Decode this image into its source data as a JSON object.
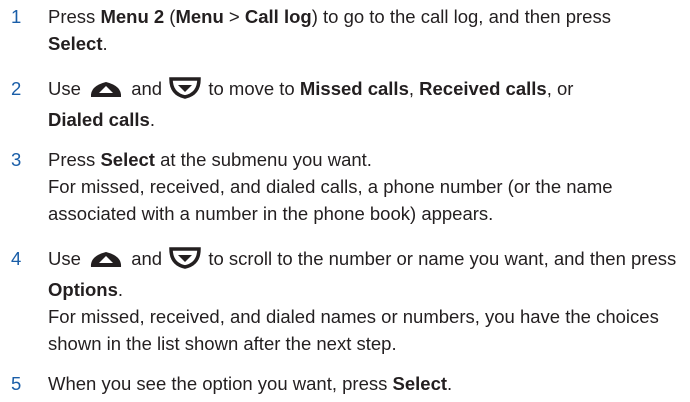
{
  "steps": [
    {
      "number": "1",
      "a1": "Press ",
      "menu_key": "Menu 2",
      "a2": " (",
      "menu": "Menu",
      "a3": " > ",
      "call_log": "Call log",
      "a4": ") to go to the call log, and then press",
      "select": "Select",
      "a5": "."
    },
    {
      "number": "2",
      "a1": "Use",
      "up_key": "scroll-up-key-icon",
      "a2": "and",
      "down_key": "scroll-down-key-icon",
      "a3": "to move to ",
      "missed": "Missed calls",
      "a4": ", ",
      "received": "Received calls",
      "a5": ", or",
      "dialed": "Dialed calls",
      "a6": "."
    },
    {
      "number": "3",
      "a1": "Press ",
      "select": "Select",
      "a2": " at the submenu you want.",
      "note": "For missed, received, and dialed calls, a phone number (or the name associated with a number in the phone book) appears."
    },
    {
      "number": "4",
      "a1": "Use",
      "up_key": "scroll-up-key-icon",
      "a2": "and",
      "down_key": "scroll-down-key-icon",
      "a3": "to scroll to the number or name you want, and then press ",
      "options": "Options",
      "a4": ".",
      "note": "For missed, received, and dialed names or numbers, you have the choices shown in the list shown after the next step."
    },
    {
      "number": "5",
      "a1": "When you see the option you want, press ",
      "select": "Select",
      "a2": "."
    }
  ],
  "colors": {
    "step_number": "#1a5ea8",
    "text": "#231f20",
    "key_fill": "#231f20"
  }
}
